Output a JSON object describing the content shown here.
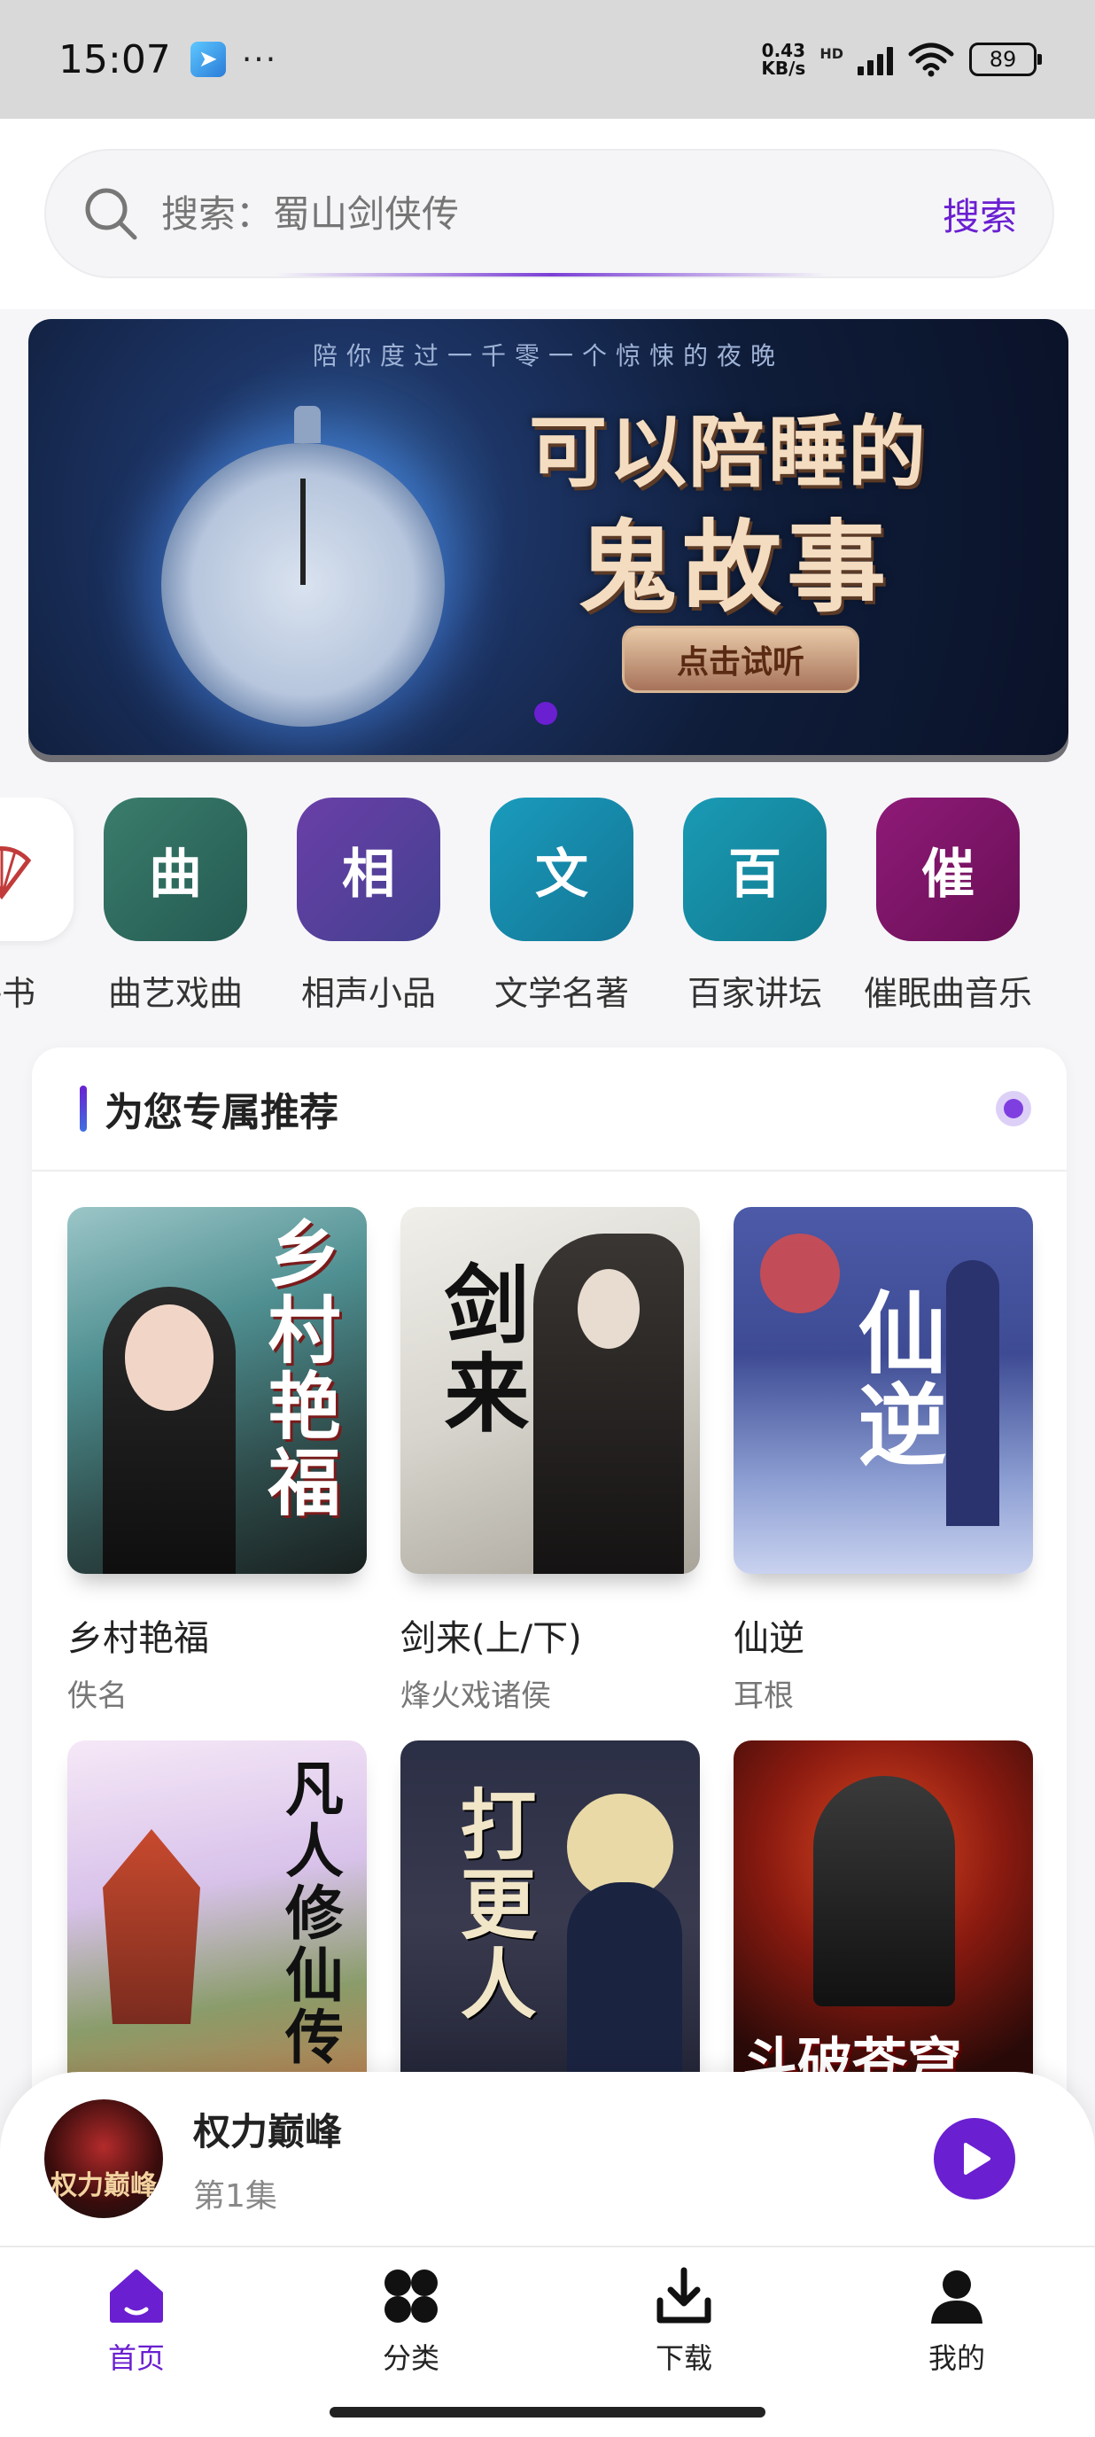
{
  "status_bar": {
    "time": "15:07",
    "dots": "···",
    "net_speed_value": "0.43",
    "net_speed_unit": "KB/s",
    "network_type": "HD",
    "battery": "89"
  },
  "search": {
    "placeholder": "搜索：蜀山剑侠传",
    "button_label": "搜索"
  },
  "banner": {
    "top_text": "陪你度过一千零一个惊悚的夜晚",
    "title_line1": "可以陪睡的",
    "title_line2": "鬼故事",
    "cta_label": "点击试听"
  },
  "categories": [
    {
      "icon_char": "",
      "label": "评书",
      "color": "#ffffff"
    },
    {
      "icon_char": "曲",
      "label": "曲艺戏曲",
      "color": "#2f6e62"
    },
    {
      "icon_char": "相",
      "label": "相声小品",
      "color": "#5a3f9a"
    },
    {
      "icon_char": "文",
      "label": "文学名著",
      "color": "#1a86a8"
    },
    {
      "icon_char": "百",
      "label": "百家讲坛",
      "color": "#1788a0"
    },
    {
      "icon_char": "催",
      "label": "催眠曲音乐",
      "color": "#7d1566"
    }
  ],
  "recommend": {
    "title": "为您专属推荐",
    "books": [
      {
        "title": "乡村艳福",
        "author": "佚名",
        "cover_text": "乡村艳福"
      },
      {
        "title": "剑来(上/下)",
        "author": "烽火戏诸侯",
        "cover_text": "剑来"
      },
      {
        "title": "仙逆",
        "author": "耳根",
        "cover_text": "仙逆"
      },
      {
        "title": "",
        "author": "",
        "cover_text": "凡人修仙传"
      },
      {
        "title": "",
        "author": "",
        "cover_text": "打更人"
      },
      {
        "title": "",
        "author": "",
        "cover_text": "斗破苍穹"
      }
    ]
  },
  "player": {
    "title": "权力巅峰",
    "episode": "第1集",
    "cover_text": "权力巅峰"
  },
  "nav": [
    {
      "label": "首页",
      "icon": "home-icon",
      "active": true
    },
    {
      "label": "分类",
      "icon": "grid-icon",
      "active": false
    },
    {
      "label": "下载",
      "icon": "download-icon",
      "active": false
    },
    {
      "label": "我的",
      "icon": "user-icon",
      "active": false
    }
  ],
  "colors": {
    "accent": "#6a1fd1"
  }
}
